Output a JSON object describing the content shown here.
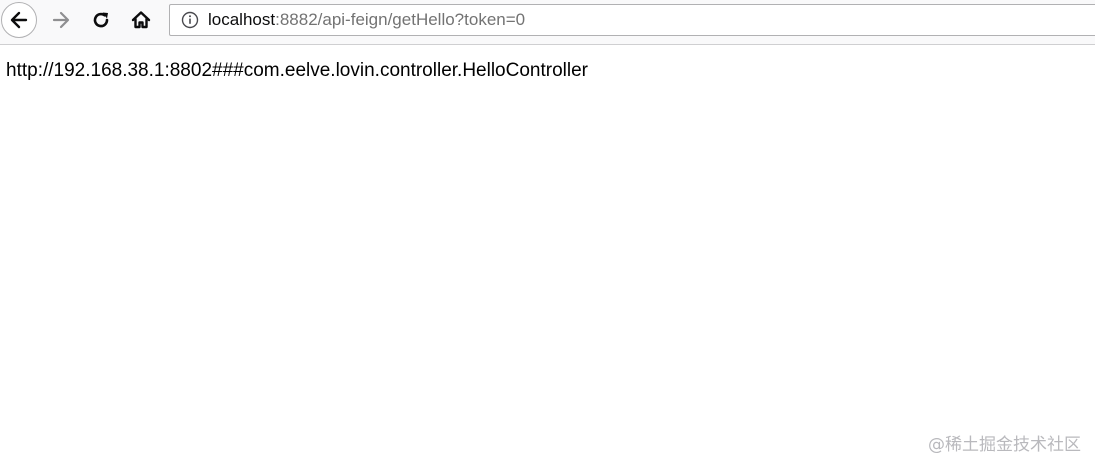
{
  "toolbar": {
    "back_icon": "arrow-left-icon",
    "forward_icon": "arrow-right-icon",
    "reload_icon": "reload-icon",
    "home_icon": "home-icon",
    "info_icon": "info-circle-icon"
  },
  "urlbar": {
    "host": "localhost",
    "rest": ":8882/api-feign/getHello?token=0"
  },
  "page": {
    "text": "http://192.168.38.1:8802###com.eelve.lovin.controller.HelloController"
  },
  "watermark": {
    "text": "@稀土掘金技术社区"
  }
}
